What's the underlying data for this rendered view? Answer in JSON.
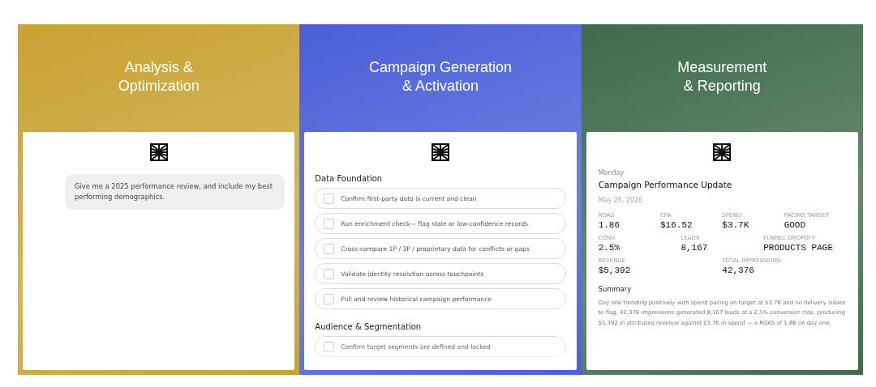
{
  "panels": [
    {
      "kind": "chat",
      "title": "Analysis &\nOptimization",
      "color": "#c9a232",
      "message": "Give me a 2025 performance review, and include my best performing demographics."
    },
    {
      "kind": "checklist",
      "title": "Campaign Generation\n& Activation",
      "color": "#4a5fd9",
      "sections": [
        {
          "heading": "Data Foundation",
          "items": [
            {
              "label": "Confirm first-party data is current and clean",
              "checked": false
            },
            {
              "label": "Run enrichment check— flag stale or low-confidence records",
              "checked": false
            },
            {
              "label": "Cross-compare 1P / 3P / proprietary data for conflicts or gaps",
              "checked": false
            },
            {
              "label": "Validate identity resolution across touchpoints",
              "checked": false
            },
            {
              "label": "Pull and review historical campaign performance",
              "checked": false
            }
          ]
        },
        {
          "heading": "Audience & Segmentation",
          "items": [
            {
              "label": "Confirm target segments are defined and locked",
              "checked": false
            }
          ]
        }
      ]
    },
    {
      "kind": "report",
      "title": "Measurement\n& Reporting",
      "color": "#3f6b4c",
      "day": "Monday",
      "heading": "Campaign Performance Update",
      "date": "May 26, 2026",
      "metric_rows": [
        [
          {
            "label": "ROAS",
            "value": "1.86"
          },
          {
            "label": "CPA",
            "value": "$16.52"
          },
          {
            "label": "SPEND",
            "value": "$3.7K"
          },
          {
            "label": "PACING TARGET",
            "value": "GOOD"
          }
        ],
        [
          {
            "label": "CONV.",
            "value": "2.5%"
          },
          {
            "label": "LEADS",
            "value": "8,167"
          },
          {
            "label": "FUNNEL DROPOFF",
            "value": "PRODUCTS PAGE"
          }
        ],
        [
          {
            "label": "REVENUE",
            "value": "$5,392"
          },
          {
            "label": "TOTAL IMPRESSIONS",
            "value": "42,376"
          }
        ]
      ],
      "summary_heading": "Summary",
      "summary": "Day one trending positively with spend pacing on target at $3.7K and no delivery issues to flag. 42,376 impressions generated 8,167 leads at a 2.5% conversion rate, producing $5,392 in attributed revenue against $3.7K in spend — a ROAS of 1.86 on day one."
    }
  ]
}
